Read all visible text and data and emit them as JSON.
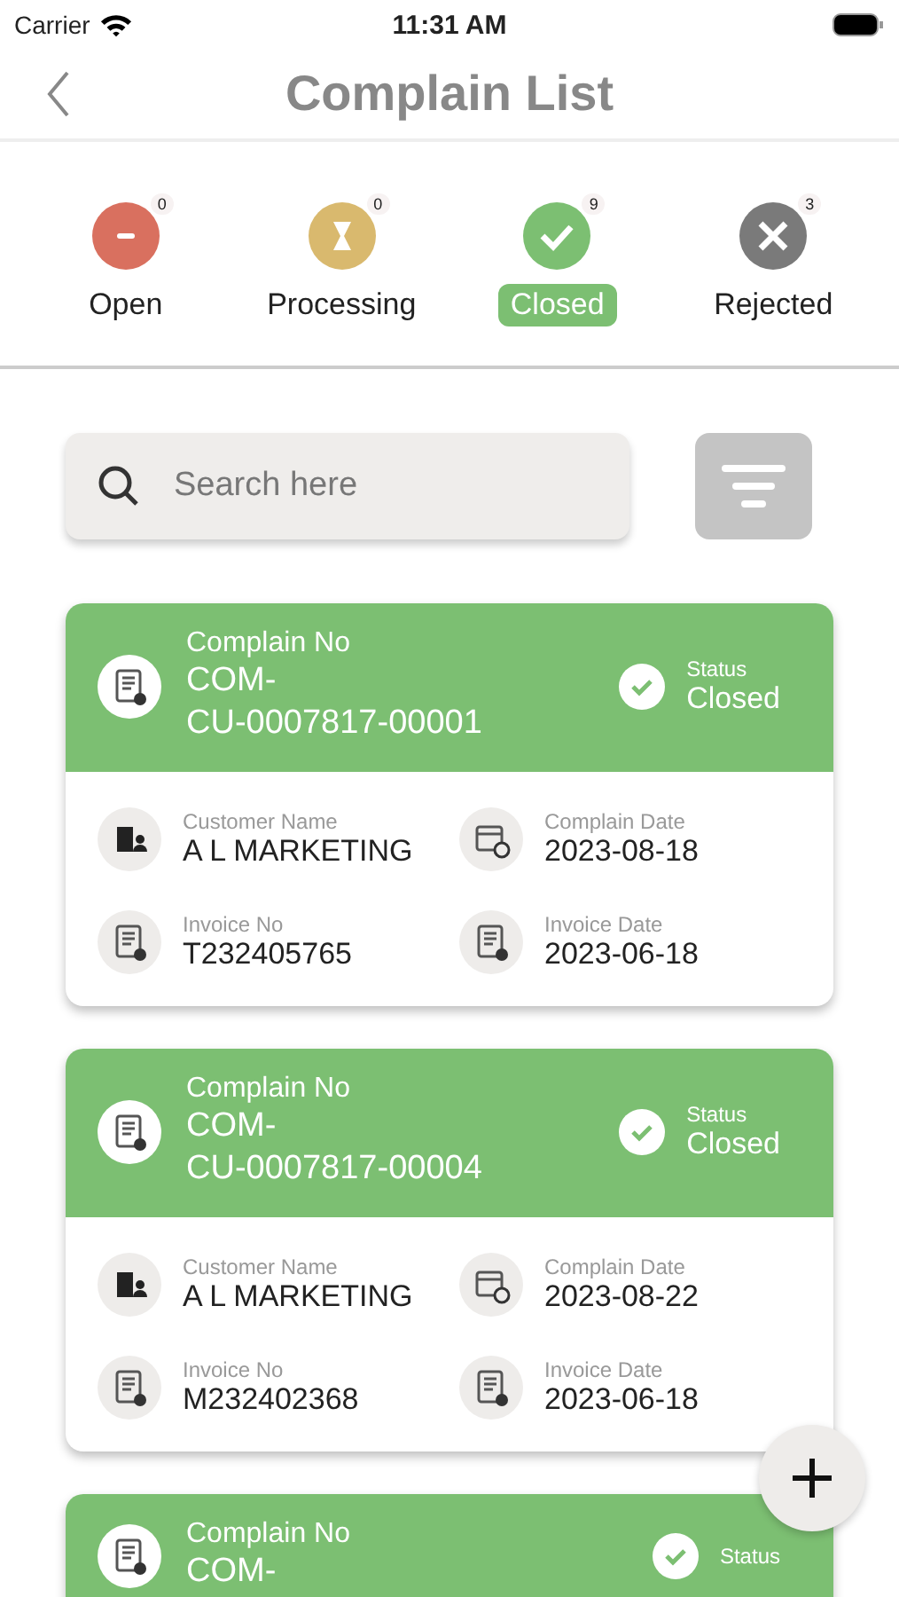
{
  "status_bar": {
    "carrier": "Carrier",
    "time": "11:31 AM"
  },
  "header": {
    "title": "Complain List"
  },
  "filters": [
    {
      "kind": "open",
      "label": "Open",
      "count": "0",
      "color": "#d9705f",
      "selected": false
    },
    {
      "kind": "processing",
      "label": "Processing",
      "count": "0",
      "color": "#d9b96e",
      "selected": false
    },
    {
      "kind": "closed",
      "label": "Closed",
      "count": "9",
      "color": "#7cbf72",
      "selected": true
    },
    {
      "kind": "rejected",
      "label": "Rejected",
      "count": "3",
      "color": "#7a7a7a",
      "selected": false
    }
  ],
  "search": {
    "placeholder": "Search here"
  },
  "complaints": [
    {
      "complain_label": "Complain No",
      "complain_no": "COM-\nCU-0007817-00001",
      "status_label": "Status",
      "status": "Closed",
      "details": [
        {
          "kind": "customer",
          "label": "Customer Name",
          "value": "A L MARKETING"
        },
        {
          "kind": "calendar",
          "label": "Complain Date",
          "value": "2023-08-18"
        },
        {
          "kind": "document",
          "label": "Invoice No",
          "value": "T232405765"
        },
        {
          "kind": "document",
          "label": "Invoice Date",
          "value": "2023-06-18"
        }
      ]
    },
    {
      "complain_label": "Complain No",
      "complain_no": "COM-\nCU-0007817-00004",
      "status_label": "Status",
      "status": "Closed",
      "details": [
        {
          "kind": "customer",
          "label": "Customer Name",
          "value": "A L MARKETING"
        },
        {
          "kind": "calendar",
          "label": "Complain Date",
          "value": "2023-08-22"
        },
        {
          "kind": "document",
          "label": "Invoice No",
          "value": "M232402368"
        },
        {
          "kind": "document",
          "label": "Invoice Date",
          "value": "2023-06-18"
        }
      ]
    },
    {
      "complain_label": "Complain No",
      "complain_no": "COM-",
      "status_label": "Status"
    }
  ]
}
